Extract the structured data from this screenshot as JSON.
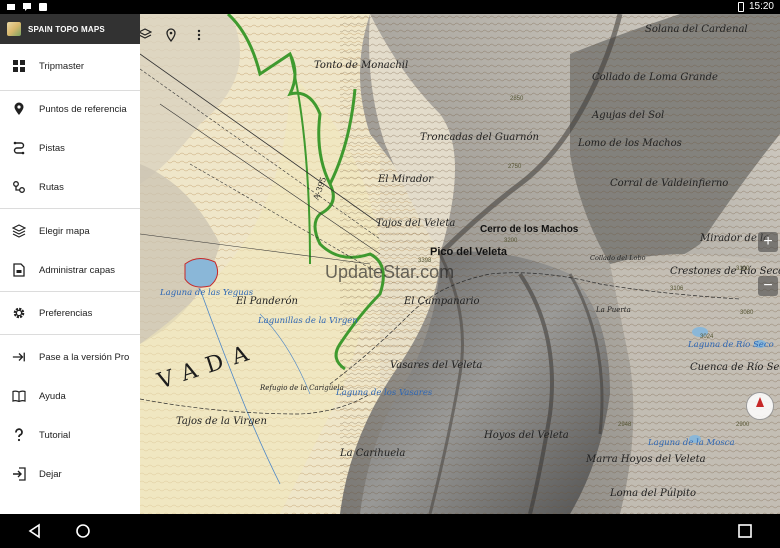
{
  "status_bar": {
    "time": "15:20",
    "icons": [
      "notification-icon",
      "notification-icon",
      "notification-icon",
      "battery-icon"
    ]
  },
  "app": {
    "title": "SPAIN TOPO MAPS",
    "icon": "app-icon"
  },
  "menu": {
    "items": [
      {
        "label": "Tripmaster",
        "icon": "grid-icon"
      },
      {
        "label": "Puntos de referencia",
        "icon": "pin-icon"
      },
      {
        "label": "Pistas",
        "icon": "track-icon"
      },
      {
        "label": "Rutas",
        "icon": "route-icon"
      },
      {
        "label": "Elegir mapa",
        "icon": "layers-icon"
      },
      {
        "label": "Administrar capas",
        "icon": "file-icon"
      },
      {
        "label": "Preferencias",
        "icon": "gear-icon"
      },
      {
        "label": "Pase a la versión Pro",
        "icon": "arrow-icon"
      },
      {
        "label": "Ayuda",
        "icon": "book-icon"
      },
      {
        "label": "Tutorial",
        "icon": "help-icon"
      },
      {
        "label": "Dejar",
        "icon": "exit-icon"
      }
    ]
  },
  "map": {
    "watermark": "UpdateStar.com",
    "peak_labels": [
      "Cerro de los Machos",
      "Pico del Veleta"
    ],
    "place_labels": [
      "Tonto de Monachil",
      "Collado de Loma Grande",
      "Solana del Cardenal",
      "Troncadas del Guarnón",
      "El Mirador",
      "Tajos del Veleta",
      "Lomo de los Machos",
      "Corral de Valdeinfierno",
      "Mirador de la",
      "El Panderón",
      "El Campanario",
      "Vasares del Veleta",
      "Refugio de la Carigüela",
      "Tajos de la Virgen",
      "La Carihuela",
      "Hoyos del Veleta",
      "Marra Hoyos del Veleta",
      "Crestones de Río Seco",
      "Cuenca de Río Seco",
      "Loma del Púlpito",
      "Collado del Lobo",
      "Agujas del Sol",
      "La Puerta"
    ],
    "water_labels": [
      "Lagunillas de la Virgen",
      "Laguna de los Vasares",
      "Laguna de la Mosca",
      "Laguna de las Yeguas",
      "Laguna de Río Seco"
    ],
    "region_label": "VADA",
    "road_label": "A-395",
    "elevation_labels": [
      "3398",
      "3106",
      "3024",
      "2850",
      "2948",
      "3080",
      "3200",
      "2750",
      "3100",
      "2900"
    ],
    "toolbar_icons": [
      "layers-icon",
      "pin-icon",
      "more-icon"
    ],
    "zoom_in_label": "+",
    "zoom_out_label": "−",
    "compass_icon": "compass-icon"
  },
  "nav_bar": {
    "buttons": [
      "back-icon",
      "home-icon",
      "recents-icon"
    ]
  }
}
